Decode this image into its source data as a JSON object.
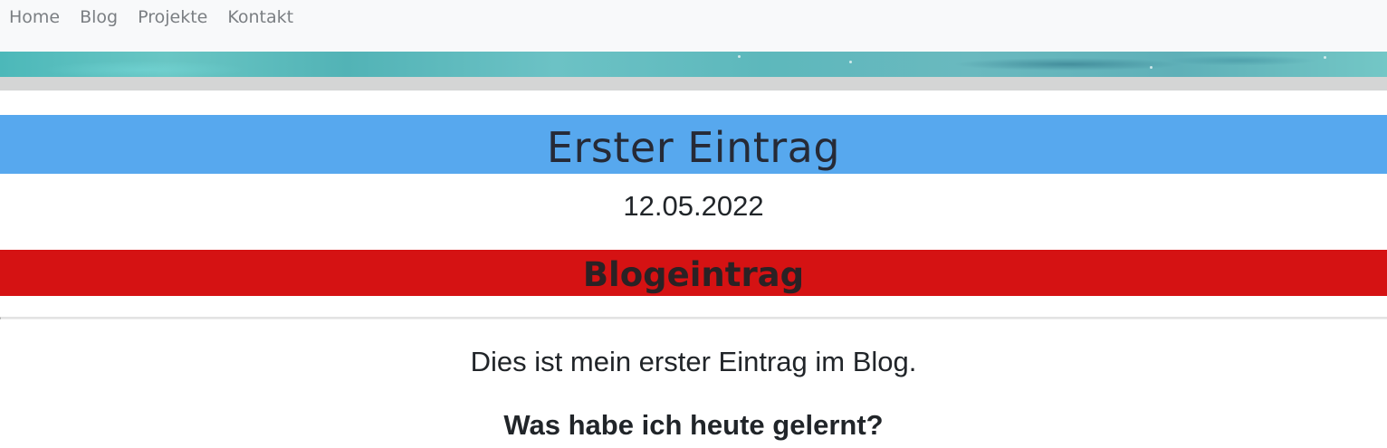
{
  "nav": {
    "items": [
      {
        "label": "Home"
      },
      {
        "label": "Blog"
      },
      {
        "label": "Projekte"
      },
      {
        "label": "Kontakt"
      }
    ]
  },
  "post": {
    "title": "Erster Eintrag",
    "date": "12.05.2022",
    "section_heading": "Blogeintrag",
    "intro": "Dies ist mein erster Eintrag im Blog.",
    "question_heading": "Was habe ich heute gelernt?"
  },
  "colors": {
    "title_band": "#57a8ee",
    "section_band": "#d51213",
    "navbar_bg": "#f8f9fa",
    "grey_strip": "#d4d5d5"
  }
}
